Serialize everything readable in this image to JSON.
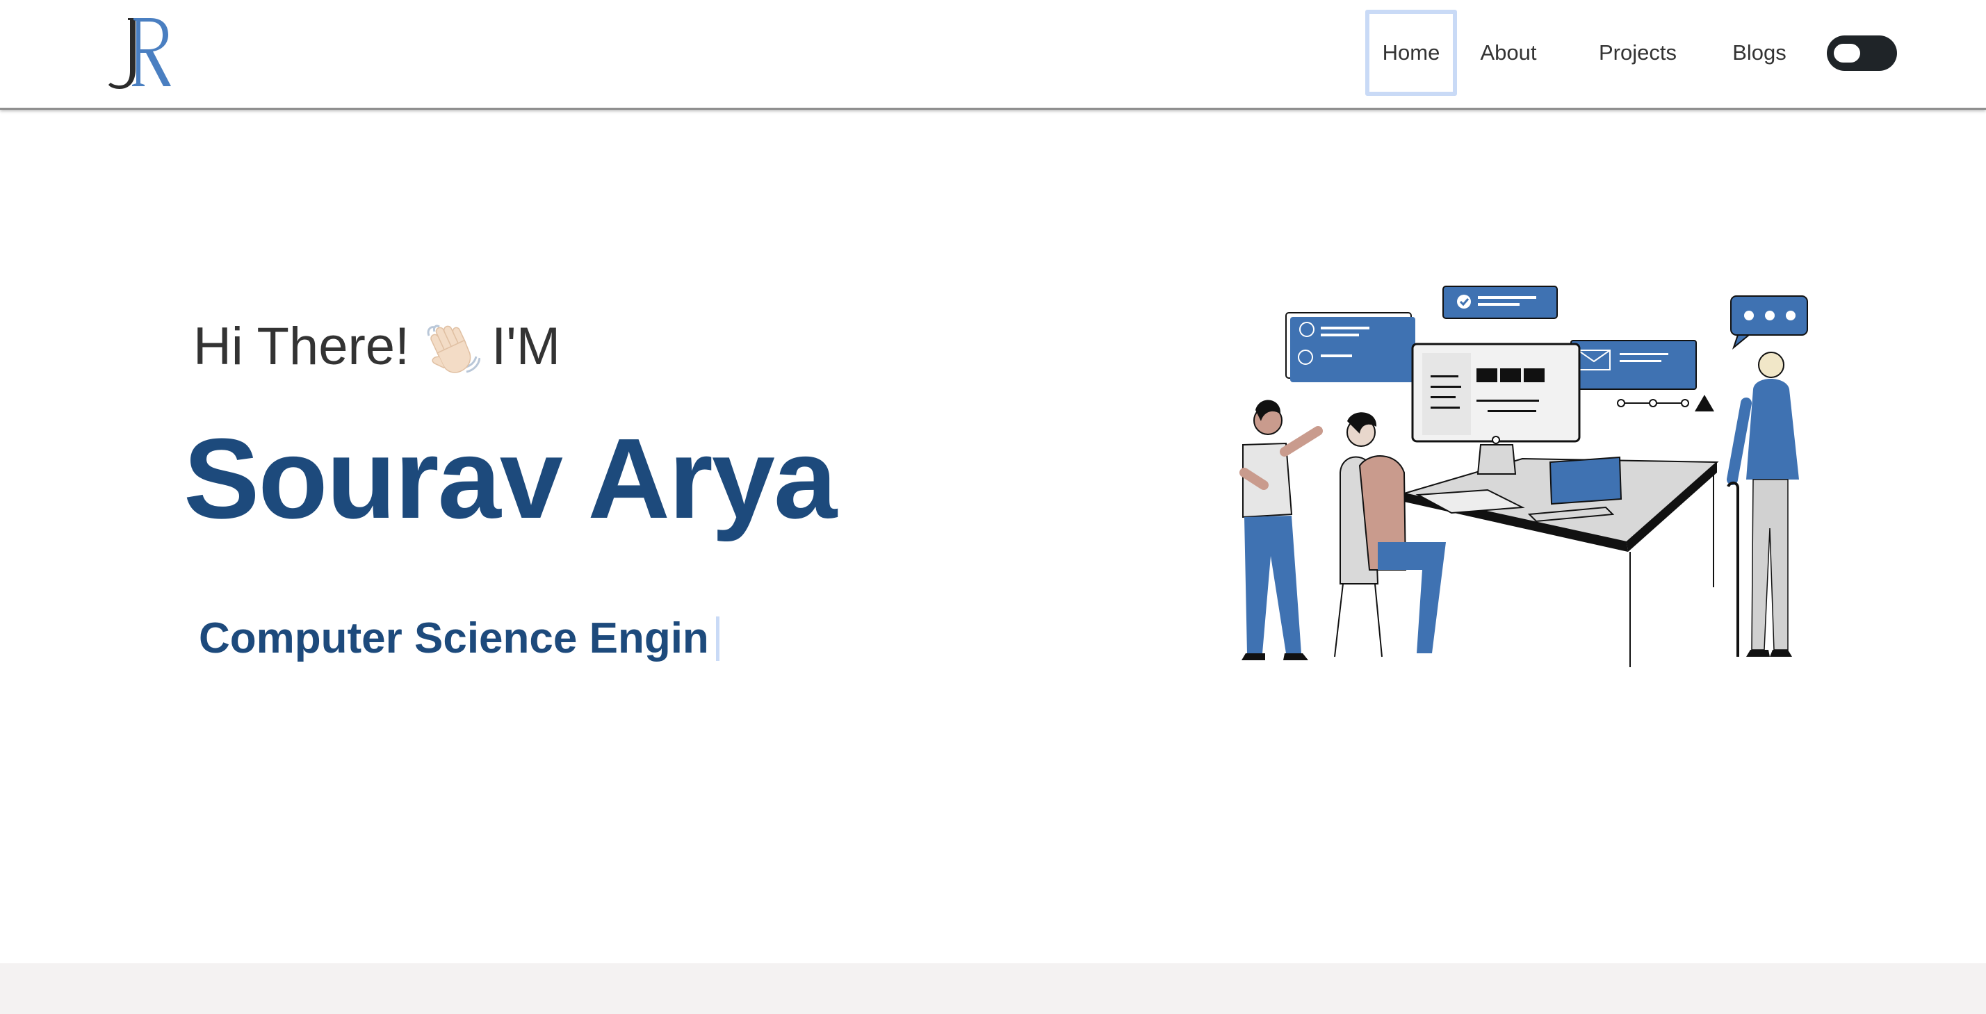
{
  "header": {
    "nav": [
      {
        "label": "Home",
        "active": true
      },
      {
        "label": "About",
        "active": false
      },
      {
        "label": "Projects",
        "active": false
      },
      {
        "label": "Blogs",
        "active": false
      }
    ],
    "theme_toggle_icon": "toggle-switch-icon"
  },
  "hero": {
    "greeting_before": "Hi There!",
    "wave_icon": "waving-hand-icon",
    "greeting_after": "I'M",
    "name": "Sourav Arya",
    "role_typed": "Computer Science Engin"
  },
  "colors": {
    "brand_blue": "#1d4a7c",
    "accent_blue": "#3f7abd",
    "active_outline": "#c9daf6",
    "footer_band": "#f4f2f2"
  }
}
